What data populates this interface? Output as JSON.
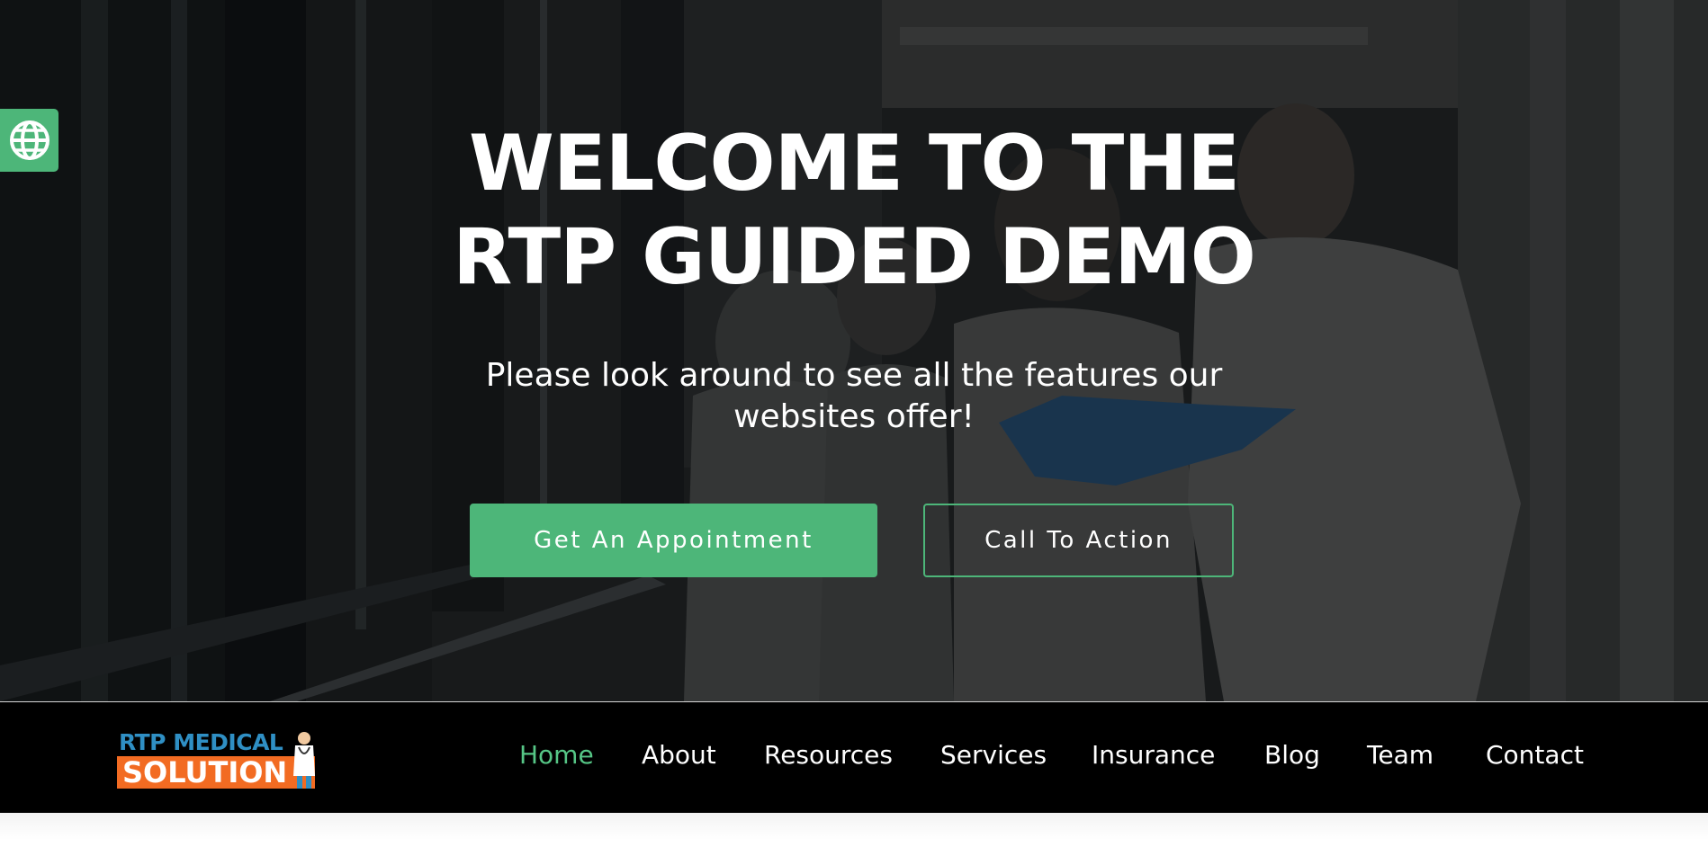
{
  "hero": {
    "title_line1": "WELCOME TO THE",
    "title_line2": "RTP GUIDED DEMO",
    "subtitle_line1": "Please look around to see all the features our",
    "subtitle_line2": "websites offer!",
    "primary_button": "Get An Appointment",
    "secondary_button": "Call To Action"
  },
  "language_button": {
    "icon": "globe-icon"
  },
  "logo": {
    "line1": "RTP MEDICAL",
    "line2": "SOLUTION"
  },
  "nav": {
    "items": [
      {
        "label": "Home",
        "active": true
      },
      {
        "label": "About",
        "active": false
      },
      {
        "label": "Resources",
        "active": false
      },
      {
        "label": "Services",
        "active": false
      },
      {
        "label": "Insurance",
        "active": false
      },
      {
        "label": "Blog",
        "active": false
      },
      {
        "label": "Team",
        "active": false
      },
      {
        "label": "Contact",
        "active": false
      }
    ]
  },
  "colors": {
    "accent": "#4db679",
    "nav_active": "#56c686",
    "logo_blue": "#2f8fc4",
    "logo_orange": "#f26b22",
    "navbar_bg": "#000000"
  }
}
